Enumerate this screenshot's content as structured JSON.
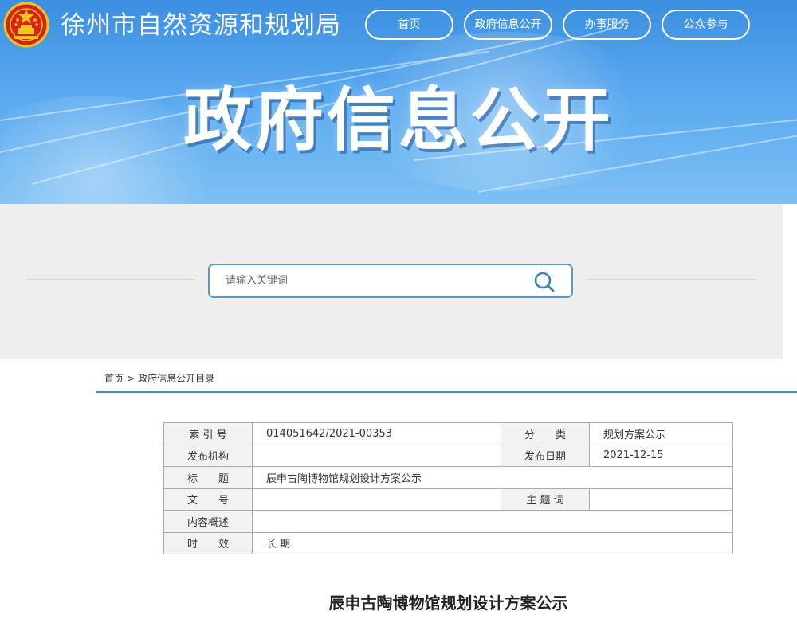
{
  "header": {
    "org_name": "徐州市自然资源和规划局",
    "nav": [
      {
        "label": "首页"
      },
      {
        "label": "政府信息公开"
      },
      {
        "label": "办事服务"
      },
      {
        "label": "公众参与"
      }
    ],
    "hero_title": "政府信息公开"
  },
  "search": {
    "placeholder": "请输入关键词"
  },
  "breadcrumb": {
    "home": "首页",
    "separator": ">",
    "current": "政府信息公开目录"
  },
  "info": {
    "index_label": "索 引 号",
    "index_value": "014051642/2021-00353",
    "category_label": "分　　类",
    "category_value": "规划方案公示",
    "publisher_label": "发布机构",
    "publisher_value": "",
    "date_label": "发布日期",
    "date_value": "2021-12-15",
    "title_label": "标　　题",
    "title_value": "辰申古陶博物馆规划设计方案公示",
    "docno_label": "文　　号",
    "docno_value": "",
    "keyword_label": "主 题 词",
    "keyword_value": "",
    "summary_label": "内容概述",
    "summary_value": "",
    "validity_label": "时　　效",
    "validity_value": "长 期"
  },
  "article": {
    "title": "辰申古陶博物馆规划设计方案公示"
  },
  "colors": {
    "banner_blue": "#4a9ae6",
    "accent_line": "#3f8fd2",
    "search_border": "#5a98c8"
  }
}
